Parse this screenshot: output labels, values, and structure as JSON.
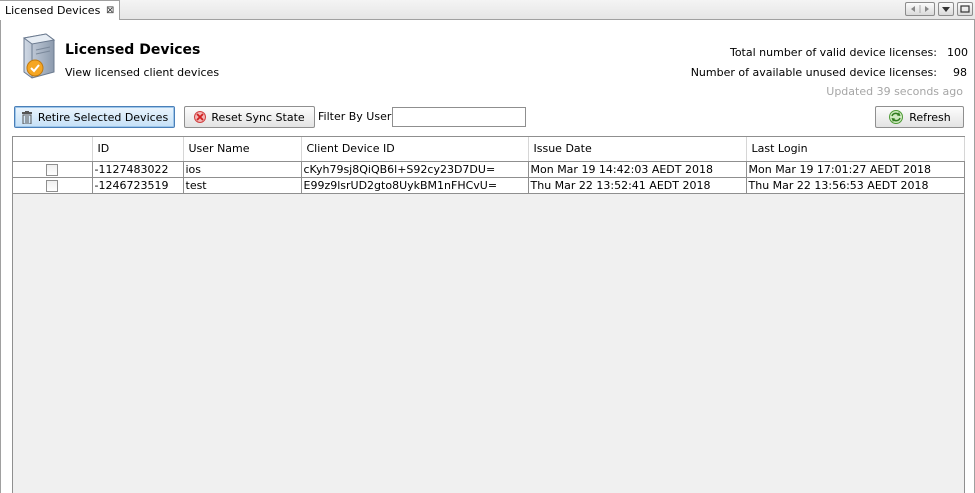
{
  "tab": {
    "label": "Licensed Devices",
    "close_glyph": "⊠"
  },
  "header": {
    "title": "Licensed Devices",
    "subtitle": "View licensed client devices",
    "icon": "server-device-icon"
  },
  "stats": {
    "total_label": "Total number of valid device licenses:",
    "total_value": "100",
    "unused_label": "Number of available unused device licenses:",
    "unused_value": "98",
    "updated": "Updated 39 seconds ago"
  },
  "toolbar": {
    "retire_label": "Retire Selected Devices",
    "reset_label": "Reset Sync State",
    "filter_label": "Filter By User:",
    "filter_value": "",
    "refresh_label": "Refresh"
  },
  "table": {
    "columns": [
      "",
      "ID",
      "User Name",
      "Client Device ID",
      "Issue Date",
      "Last Login"
    ],
    "rows": [
      {
        "checked": false,
        "id": "-1127483022",
        "user": "ios",
        "device_id": "cKyh79sj8QiQB6l+S92cy23D7DU=",
        "issue_date": "Mon Mar 19 14:42:03 AEDT 2018",
        "last_login": "Mon Mar 19 17:01:27 AEDT 2018"
      },
      {
        "checked": false,
        "id": "-1246723519",
        "user": "test",
        "device_id": "E99z9lsrUD2gto8UykBM1nFHCvU=",
        "issue_date": "Thu Mar 22 13:52:41 AEDT 2018",
        "last_login": "Thu Mar 22 13:56:53 AEDT 2018"
      }
    ]
  },
  "colors": {
    "selected_button": "#c6e1f7",
    "updated_text": "#a6a6a6"
  }
}
